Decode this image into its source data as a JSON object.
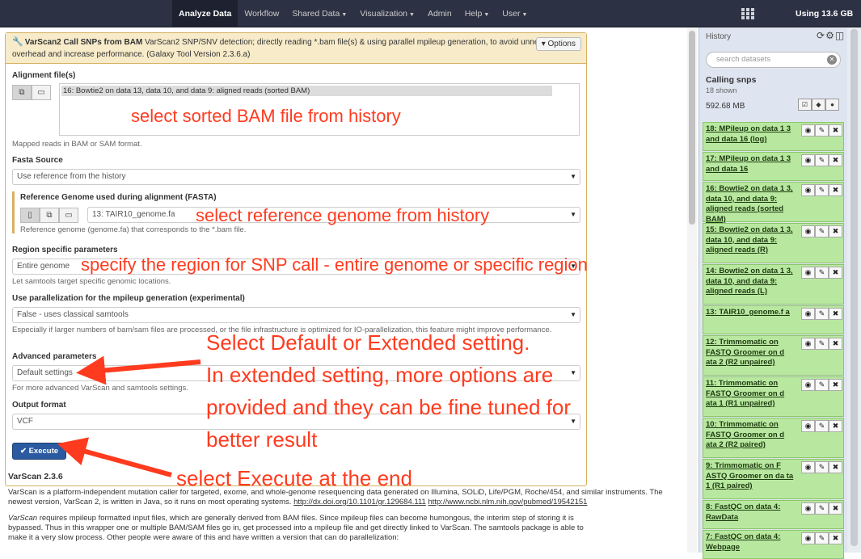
{
  "masthead": {
    "nav": [
      {
        "label": "Analyze Data",
        "active": true,
        "dropdown": false
      },
      {
        "label": "Workflow",
        "active": false,
        "dropdown": false
      },
      {
        "label": "Shared Data",
        "active": false,
        "dropdown": true
      },
      {
        "label": "Visualization",
        "active": false,
        "dropdown": true
      },
      {
        "label": "Admin",
        "active": false,
        "dropdown": false
      },
      {
        "label": "Help",
        "active": false,
        "dropdown": true
      },
      {
        "label": "User",
        "active": false,
        "dropdown": true
      }
    ],
    "usage": "Using 13.6 GB"
  },
  "tool": {
    "title": "VarScan2 Call SNPs from BAM",
    "description": "VarScan2 SNP/SNV detection; directly reading *.bam file(s) & using parallel mpileup generation, to avoid unnecessary I/O overhead and increase performance. (Galaxy Tool Version 2.3.6.a)",
    "options_label": "Options",
    "alignment_label": "Alignment file(s)",
    "alignment_selected": "16: Bowtie2 on data 13, data 10, and data 9: aligned reads (sorted BAM)",
    "alignment_help": "Mapped reads in BAM or SAM format.",
    "fasta_label": "Fasta Source",
    "fasta_value": "Use reference from the history",
    "ref_label": "Reference Genome used during alignment (FASTA)",
    "ref_value": "13: TAIR10_genome.fa",
    "ref_help": "Reference genome (genome.fa) that corresponds to the *.bam file.",
    "region_label": "Region specific parameters",
    "region_value": "Entire genome",
    "region_help": "Let samtools target specific genomic locations.",
    "parallel_label": "Use parallelization for the mpileup generation (experimental)",
    "parallel_value": "False - uses classical samtools",
    "parallel_help": "Especially if larger numbers of bam/sam files are processed, or the file infrastructure is optimized for IO-parallelization, this feature might improve performance.",
    "advanced_label": "Advanced parameters",
    "advanced_value": "Default settings",
    "advanced_help": "For more advanced VarScan and samtools settings.",
    "output_label": "Output format",
    "output_value": "VCF",
    "execute_label": "Execute"
  },
  "help": {
    "heading": "VarScan 2.3.6",
    "para1": "VarScan is a platform-independent mutation caller for targeted, exome, and whole-genome resequencing data generated on Illumina, SOLiD, Life/PGM, Roche/454, and similar instruments. The newest version, VarScan 2, is written in Java, so it runs on most operating systems.",
    "link1": "http://dx.doi.org/10.1101/gr.129684.111",
    "link2": "http://www.ncbi.nlm.nih.gov/pubmed/19542151",
    "para2_lead": "VarScan",
    "para2": " requires mpileup formatted input files, which are generally derived from BAM files. Since mpileup files can become humongous, the interim step of storing it is",
    "para3": "bypassed. Thus in this wrapper one or multiple BAM/SAM files go in, get processed into a mpileup file and get directly linked to VarScan. The samtools package is able to",
    "para4": "make it a very slow process. Other people were aware of this and have written a version that can do parallelization:"
  },
  "history": {
    "title": "History",
    "search_placeholder": "search datasets",
    "name": "Calling snps",
    "shown": "18 shown",
    "size": "592.68 MB",
    "items": [
      {
        "text": "18: MPileup on data 1 3 and data 16 (log)"
      },
      {
        "text": "17: MPileup on data 1 3 and data 16"
      },
      {
        "text": "16: Bowtie2 on data 1 3, data 10, and data 9: aligned reads (sorted BAM)"
      },
      {
        "text": "15: Bowtie2 on data 1 3, data 10, and data 9: aligned reads (R)"
      },
      {
        "text": "14: Bowtie2 on data 1 3, data 10, and data 9: aligned reads (L)"
      },
      {
        "text": "13: TAIR10_genome.f a"
      },
      {
        "text": "12: Trimmomatic on FASTQ Groomer on d ata 2 (R2 unpaired)"
      },
      {
        "text": "11: Trimmomatic on FASTQ Groomer on d ata 1 (R1 unpaired)"
      },
      {
        "text": "10: Trimmomatic on FASTQ Groomer on d ata 2 (R2 paired)"
      },
      {
        "text": "9: Trimmomatic on F ASTQ Groomer on da ta 1 (R1 paired)"
      },
      {
        "text": "8: FastQC on data 4: RawData"
      },
      {
        "text": "7: FastQC on data 4: Webpage"
      }
    ]
  },
  "annotations": {
    "a1": "select sorted BAM file from history",
    "a2": "select reference genome from history",
    "a3": "specify the region for SNP call - entire genome or specific region",
    "a4_line1": "Select Default or Extended setting.",
    "a4_line2": "In extended setting, more options are",
    "a4_line3": "provided and they can be fine tuned for",
    "a4_line4": "better result",
    "a5": "select Execute at the end",
    "color": "#ff3b1f"
  }
}
